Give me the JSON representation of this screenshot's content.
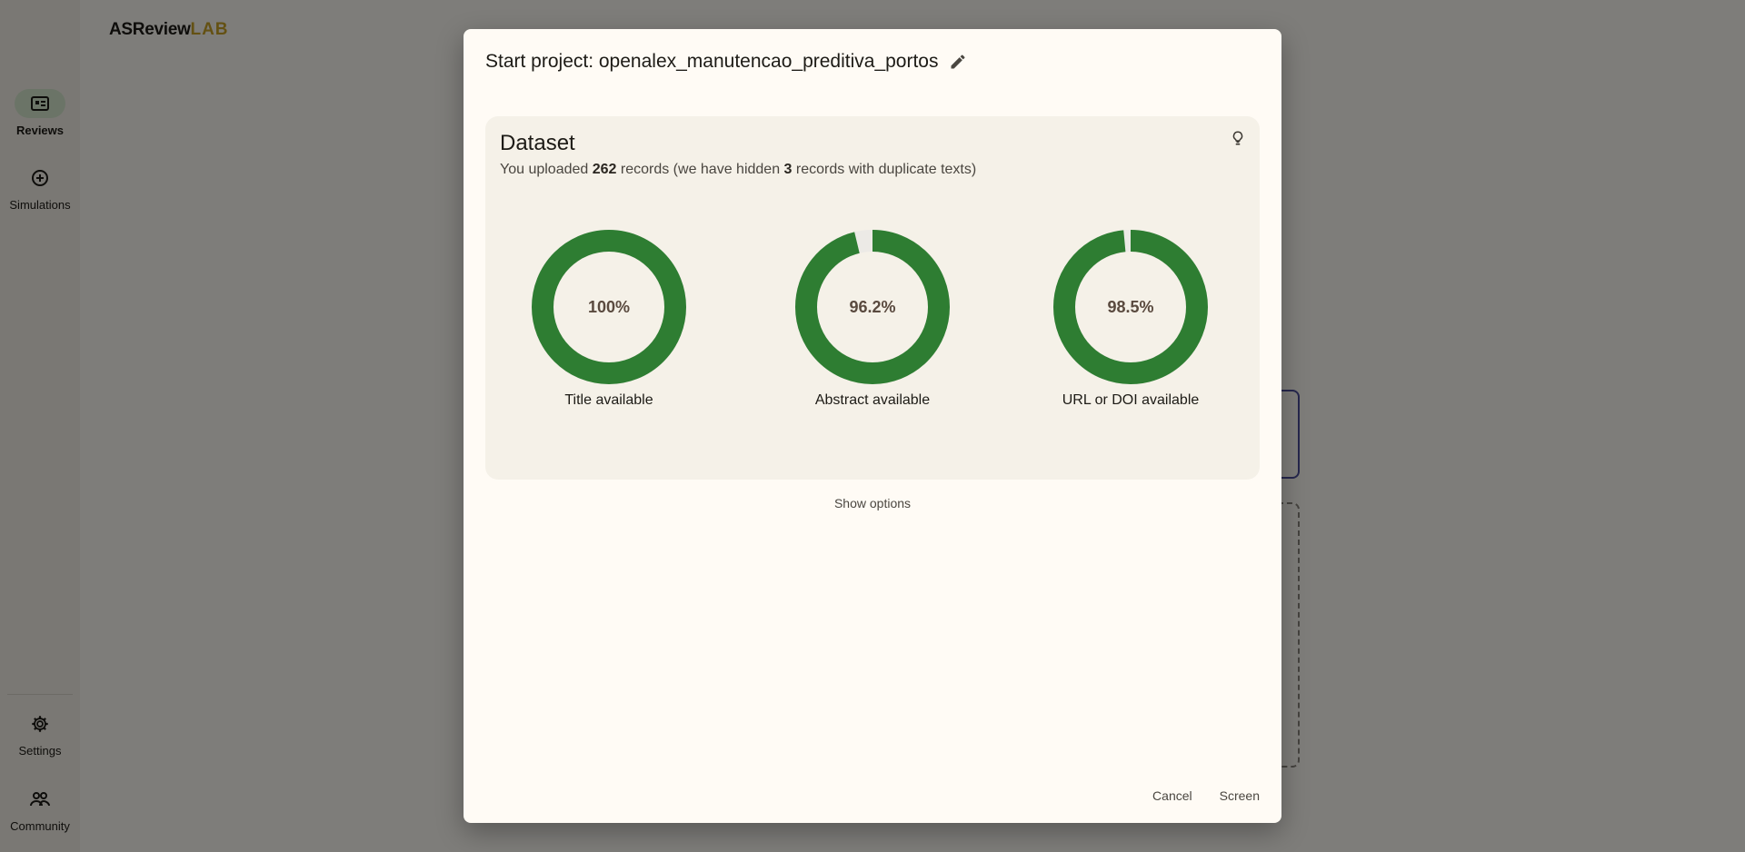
{
  "app": {
    "logo_main": "ASReview",
    "logo_lab": "LAB",
    "nav": [
      {
        "label": "Reviews",
        "icon": "reviews-icon",
        "active": true
      },
      {
        "label": "Simulations",
        "icon": "simulations-icon",
        "active": false
      },
      {
        "label": "Settings",
        "icon": "gear-icon",
        "active": false
      },
      {
        "label": "Community",
        "icon": "community-icon",
        "active": false
      }
    ]
  },
  "dialog": {
    "title": "Start project: openalex_manutencao_preditiva_portos",
    "dataset": {
      "title": "Dataset",
      "sub_prefix": "You uploaded ",
      "records": "262",
      "sub_mid": " records (we have hidden ",
      "hidden": "3",
      "sub_suffix": " records with duplicate texts)"
    },
    "stats": [
      {
        "value": "100%",
        "fraction": 1.0,
        "label": "Title available"
      },
      {
        "value": "96.2%",
        "fraction": 0.962,
        "label": "Abstract available"
      },
      {
        "value": "98.5%",
        "fraction": 0.985,
        "label": "URL or DOI available"
      }
    ],
    "show_options": "Show options",
    "cancel": "Cancel",
    "screen": "Screen"
  },
  "colors": {
    "donut_fill": "#2e7d32",
    "donut_track": "#eceae6"
  }
}
